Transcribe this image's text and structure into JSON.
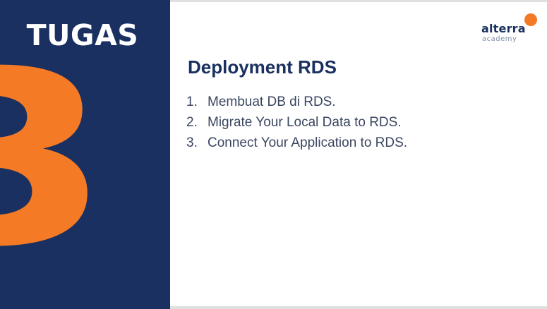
{
  "slide": {
    "section_label": "TUGAS",
    "section_number": "3",
    "title": "Deployment RDS",
    "tasks": [
      {
        "number": "1.",
        "text": "Membuat DB di RDS."
      },
      {
        "number": "2.",
        "text": "Migrate Your Local Data to RDS."
      },
      {
        "number": "3.",
        "text": "Connect Your Application to RDS."
      }
    ]
  },
  "logo": {
    "name": "alterra",
    "subtitle": "academy"
  },
  "colors": {
    "panel_navy": "#1a3060",
    "accent_orange": "#f47a25",
    "heading_navy": "#1a3060",
    "body_text": "#3a4660"
  }
}
